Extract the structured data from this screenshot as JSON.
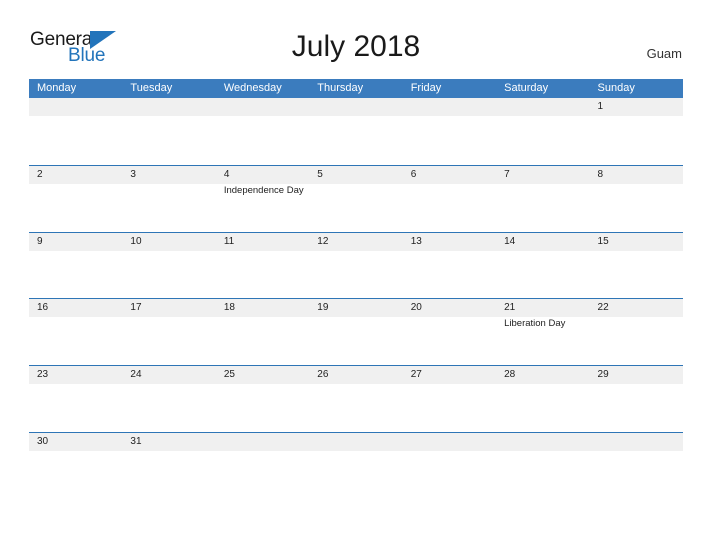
{
  "brand": {
    "name_part1": "General",
    "name_part2": "Blue",
    "color_dark": "#1a1a1a",
    "color_blue": "#2274bb"
  },
  "header": {
    "title": "July 2018",
    "region": "Guam"
  },
  "theme": {
    "header_blue": "#3b7cbe",
    "rule_blue": "#2e75b6",
    "daynum_band": "#f0f0f0",
    "text": "#222222"
  },
  "calendar": {
    "weekdays": [
      "Monday",
      "Tuesday",
      "Wednesday",
      "Thursday",
      "Friday",
      "Saturday",
      "Sunday"
    ],
    "weeks": [
      [
        {
          "day": "",
          "event": ""
        },
        {
          "day": "",
          "event": ""
        },
        {
          "day": "",
          "event": ""
        },
        {
          "day": "",
          "event": ""
        },
        {
          "day": "",
          "event": ""
        },
        {
          "day": "",
          "event": ""
        },
        {
          "day": "1",
          "event": ""
        }
      ],
      [
        {
          "day": "2",
          "event": ""
        },
        {
          "day": "3",
          "event": ""
        },
        {
          "day": "4",
          "event": "Independence Day"
        },
        {
          "day": "5",
          "event": ""
        },
        {
          "day": "6",
          "event": ""
        },
        {
          "day": "7",
          "event": ""
        },
        {
          "day": "8",
          "event": ""
        }
      ],
      [
        {
          "day": "9",
          "event": ""
        },
        {
          "day": "10",
          "event": ""
        },
        {
          "day": "11",
          "event": ""
        },
        {
          "day": "12",
          "event": ""
        },
        {
          "day": "13",
          "event": ""
        },
        {
          "day": "14",
          "event": ""
        },
        {
          "day": "15",
          "event": ""
        }
      ],
      [
        {
          "day": "16",
          "event": ""
        },
        {
          "day": "17",
          "event": ""
        },
        {
          "day": "18",
          "event": ""
        },
        {
          "day": "19",
          "event": ""
        },
        {
          "day": "20",
          "event": ""
        },
        {
          "day": "21",
          "event": "Liberation Day"
        },
        {
          "day": "22",
          "event": ""
        }
      ],
      [
        {
          "day": "23",
          "event": ""
        },
        {
          "day": "24",
          "event": ""
        },
        {
          "day": "25",
          "event": ""
        },
        {
          "day": "26",
          "event": ""
        },
        {
          "day": "27",
          "event": ""
        },
        {
          "day": "28",
          "event": ""
        },
        {
          "day": "29",
          "event": ""
        }
      ],
      [
        {
          "day": "30",
          "event": ""
        },
        {
          "day": "31",
          "event": ""
        },
        {
          "day": "",
          "event": ""
        },
        {
          "day": "",
          "event": ""
        },
        {
          "day": "",
          "event": ""
        },
        {
          "day": "",
          "event": ""
        },
        {
          "day": "",
          "event": ""
        }
      ]
    ]
  }
}
